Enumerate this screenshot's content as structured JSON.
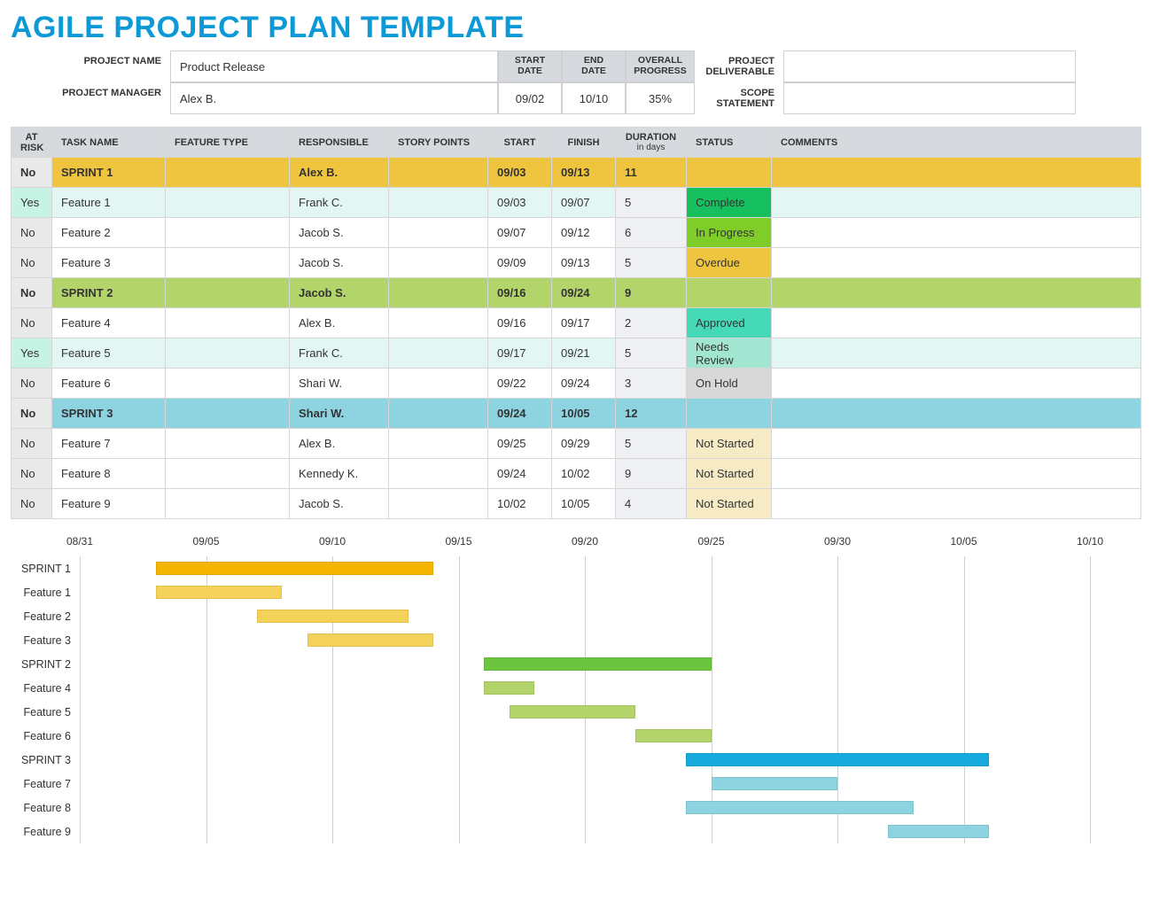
{
  "title": "AGILE PROJECT PLAN TEMPLATE",
  "meta": {
    "labels": {
      "project_name": "PROJECT NAME",
      "project_manager": "PROJECT MANAGER",
      "start_date": "START DATE",
      "end_date": "END DATE",
      "overall_progress": "OVERALL PROGRESS",
      "project_deliverable": "PROJECT DELIVERABLE",
      "scope_statement": "SCOPE STATEMENT"
    },
    "project_name": "Product Release",
    "project_manager": "Alex B.",
    "start_date": "09/02",
    "end_date": "10/10",
    "overall_progress": "35%",
    "project_deliverable": "",
    "scope_statement": ""
  },
  "table": {
    "headers": {
      "at_risk": "AT RISK",
      "task_name": "TASK NAME",
      "feature_type": "FEATURE TYPE",
      "responsible": "RESPONSIBLE",
      "story_points": "STORY POINTS",
      "start": "START",
      "finish": "FINISH",
      "duration": "DURATION",
      "duration_sub": "in days",
      "status": "STATUS",
      "comments": "COMMENTS"
    },
    "rows": [
      {
        "sprint": true,
        "color": "#efc53f",
        "at_risk": "No",
        "task_name": "SPRINT 1",
        "feature_type": "",
        "responsible": "Alex B.",
        "story_points": "",
        "start": "09/03",
        "finish": "09/13",
        "duration": "11",
        "status": "",
        "comments": ""
      },
      {
        "sprint": false,
        "at_risk": "Yes",
        "task_name": "Feature 1",
        "feature_type": "",
        "responsible": "Frank C.",
        "story_points": "",
        "start": "09/03",
        "finish": "09/07",
        "duration": "5",
        "status": "Complete",
        "status_class": "status-complete",
        "comments": ""
      },
      {
        "sprint": false,
        "at_risk": "No",
        "task_name": "Feature 2",
        "feature_type": "",
        "responsible": "Jacob S.",
        "story_points": "",
        "start": "09/07",
        "finish": "09/12",
        "duration": "6",
        "status": "In Progress",
        "status_class": "status-in-progress",
        "comments": ""
      },
      {
        "sprint": false,
        "at_risk": "No",
        "task_name": "Feature 3",
        "feature_type": "",
        "responsible": "Jacob S.",
        "story_points": "",
        "start": "09/09",
        "finish": "09/13",
        "duration": "5",
        "status": "Overdue",
        "status_class": "status-overdue",
        "comments": ""
      },
      {
        "sprint": true,
        "color": "#b3d36b",
        "at_risk": "No",
        "task_name": "SPRINT 2",
        "feature_type": "",
        "responsible": "Jacob S.",
        "story_points": "",
        "start": "09/16",
        "finish": "09/24",
        "duration": "9",
        "status": "",
        "comments": ""
      },
      {
        "sprint": false,
        "at_risk": "No",
        "task_name": "Feature 4",
        "feature_type": "",
        "responsible": "Alex B.",
        "story_points": "",
        "start": "09/16",
        "finish": "09/17",
        "duration": "2",
        "status": "Approved",
        "status_class": "status-approved",
        "comments": ""
      },
      {
        "sprint": false,
        "at_risk": "Yes",
        "task_name": "Feature 5",
        "feature_type": "",
        "responsible": "Frank C.",
        "story_points": "",
        "start": "09/17",
        "finish": "09/21",
        "duration": "5",
        "status": "Needs Review",
        "status_class": "status-needs-review",
        "comments": ""
      },
      {
        "sprint": false,
        "at_risk": "No",
        "task_name": "Feature 6",
        "feature_type": "",
        "responsible": "Shari W.",
        "story_points": "",
        "start": "09/22",
        "finish": "09/24",
        "duration": "3",
        "status": "On Hold",
        "status_class": "status-on-hold",
        "comments": ""
      },
      {
        "sprint": true,
        "color": "#8ed3e0",
        "at_risk": "No",
        "task_name": "SPRINT 3",
        "feature_type": "",
        "responsible": "Shari W.",
        "story_points": "",
        "start": "09/24",
        "finish": "10/05",
        "duration": "12",
        "status": "",
        "comments": ""
      },
      {
        "sprint": false,
        "at_risk": "No",
        "task_name": "Feature 7",
        "feature_type": "",
        "responsible": "Alex B.",
        "story_points": "",
        "start": "09/25",
        "finish": "09/29",
        "duration": "5",
        "status": "Not Started",
        "status_class": "status-not-started",
        "comments": ""
      },
      {
        "sprint": false,
        "at_risk": "No",
        "task_name": "Feature 8",
        "feature_type": "",
        "responsible": "Kennedy K.",
        "story_points": "",
        "start": "09/24",
        "finish": "10/02",
        "duration": "9",
        "status": "Not Started",
        "status_class": "status-not-started",
        "comments": ""
      },
      {
        "sprint": false,
        "at_risk": "No",
        "task_name": "Feature 9",
        "feature_type": "",
        "responsible": "Jacob S.",
        "story_points": "",
        "start": "10/02",
        "finish": "10/05",
        "duration": "4",
        "status": "Not Started",
        "status_class": "status-not-started",
        "comments": ""
      }
    ]
  },
  "chart_data": {
    "type": "bar",
    "title": "",
    "xlabel": "",
    "ylabel": "",
    "x_axis": {
      "min_day": 0,
      "max_day": 40
    },
    "ticks": [
      {
        "label": "08/31",
        "day": 0
      },
      {
        "label": "09/05",
        "day": 5
      },
      {
        "label": "09/10",
        "day": 10
      },
      {
        "label": "09/15",
        "day": 15
      },
      {
        "label": "09/20",
        "day": 20
      },
      {
        "label": "09/25",
        "day": 25
      },
      {
        "label": "09/30",
        "day": 30
      },
      {
        "label": "10/05",
        "day": 35
      },
      {
        "label": "10/10",
        "day": 40
      }
    ],
    "series": [
      {
        "name": "SPRINT 1",
        "start_day": 3,
        "end_day": 14,
        "color": "#f4b400"
      },
      {
        "name": "Feature 1",
        "start_day": 3,
        "end_day": 8,
        "color": "#f4d25a"
      },
      {
        "name": "Feature 2",
        "start_day": 7,
        "end_day": 13,
        "color": "#f4d25a"
      },
      {
        "name": "Feature 3",
        "start_day": 9,
        "end_day": 14,
        "color": "#f4d25a"
      },
      {
        "name": "SPRINT 2",
        "start_day": 16,
        "end_day": 25,
        "color": "#6cc43f"
      },
      {
        "name": "Feature 4",
        "start_day": 16,
        "end_day": 18,
        "color": "#b3d36b"
      },
      {
        "name": "Feature 5",
        "start_day": 17,
        "end_day": 22,
        "color": "#b3d36b"
      },
      {
        "name": "Feature 6",
        "start_day": 22,
        "end_day": 25,
        "color": "#b3d36b"
      },
      {
        "name": "SPRINT 3",
        "start_day": 24,
        "end_day": 36,
        "color": "#17abdd"
      },
      {
        "name": "Feature 7",
        "start_day": 25,
        "end_day": 30,
        "color": "#8ed3e0"
      },
      {
        "name": "Feature 8",
        "start_day": 24,
        "end_day": 33,
        "color": "#8ed3e0"
      },
      {
        "name": "Feature 9",
        "start_day": 32,
        "end_day": 36,
        "color": "#8ed3e0"
      }
    ]
  }
}
